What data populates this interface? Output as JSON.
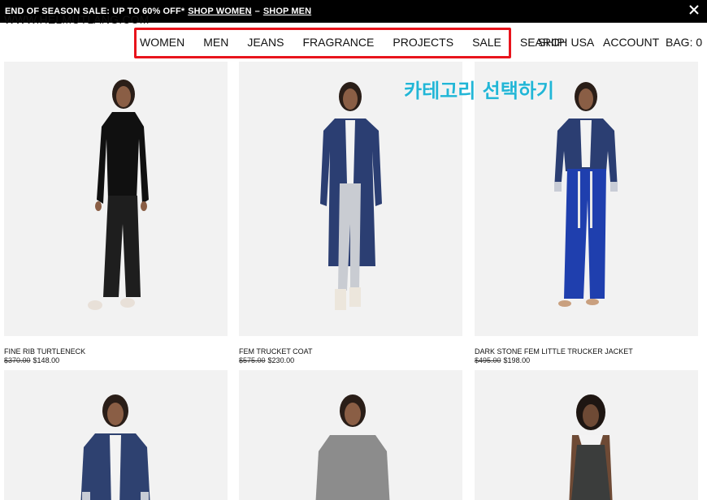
{
  "promo": {
    "text": "END OF SEASON SALE: UP TO 60% OFF*",
    "link_women": "SHOP WOMEN",
    "separator": "–",
    "link_men": "SHOP MEN",
    "close_icon": "close-icon"
  },
  "header": {
    "logo": "WWW.HELMUTLANG.COM",
    "nav": [
      "WOMEN",
      "MEN",
      "JEANS",
      "FRAGRANCE",
      "PROJECTS",
      "SALE",
      "SEARCH"
    ],
    "ship": "SHIP: USA",
    "account": "ACCOUNT",
    "bag": "BAG: 0",
    "highlight_color": "#e8141c"
  },
  "annotation": {
    "text": "카테고리 선택하기",
    "color": "#22b6d6"
  },
  "products": [
    {
      "name": "FINE RIB TURTLENECK",
      "old_price": "$370.00",
      "price": "$148.00"
    },
    {
      "name": "FEM TRUCKET COAT",
      "old_price": "$575.00",
      "price": "$230.00"
    },
    {
      "name": "DARK STONE FEM LITTLE TRUCKER JACKET",
      "old_price": "$495.00",
      "price": "$198.00"
    },
    {
      "name": "",
      "old_price": "",
      "price": ""
    },
    {
      "name": "",
      "old_price": "",
      "price": ""
    },
    {
      "name": "",
      "old_price": "",
      "price": ""
    }
  ]
}
